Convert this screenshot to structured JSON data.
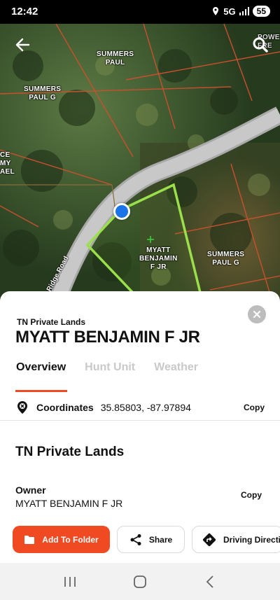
{
  "status_bar": {
    "time": "12:42",
    "network": "5G",
    "battery": "55"
  },
  "map": {
    "labels": [
      {
        "id": "summers-paul",
        "text": "SUMMERS\nPAUL"
      },
      {
        "id": "summers-paul-g-left",
        "text": "SUMMERS\nPAUL G"
      },
      {
        "id": "partial-left",
        "text": "CE\nMY\nAEL"
      },
      {
        "id": "myatt-parcel",
        "text": "MYATT\nBENJAMIN\nF JR"
      },
      {
        "id": "summers-paul-g-right",
        "text": "SUMMERS\nPAUL G"
      },
      {
        "id": "partial-top-right",
        "text": "POWE\nFRE"
      }
    ],
    "road_label": "na Ridge Road",
    "icons": {
      "back": "arrow-left-icon",
      "search": "search-icon",
      "location": "location-dot-icon"
    },
    "colors": {
      "parcel_outline": "#9be04a",
      "property_lines": "#c8502e",
      "road": "#bdbdbd",
      "location_dot": "#1a73e8"
    }
  },
  "sheet": {
    "subtitle": "TN Private Lands",
    "title": "MYATT BENJAMIN F JR",
    "tabs": [
      {
        "label": "Overview",
        "active": true
      },
      {
        "label": "Hunt Unit",
        "active": false
      },
      {
        "label": "Weather",
        "active": false
      }
    ],
    "coordinates": {
      "label": "Coordinates",
      "value": "35.85803, -87.97894",
      "copy_label": "Copy"
    },
    "section_title": "TN Private Lands",
    "owner": {
      "label": "Owner",
      "value": "MYATT BENJAMIN F JR",
      "copy_label": "Copy"
    },
    "actions": {
      "add_to_folder": "Add To Folder",
      "share": "Share",
      "driving_directions": "Driving Directi"
    },
    "colors": {
      "accent": "#f04a23"
    }
  },
  "nav_bar": {
    "icons": [
      "recent-apps-icon",
      "home-icon",
      "back-icon"
    ]
  }
}
